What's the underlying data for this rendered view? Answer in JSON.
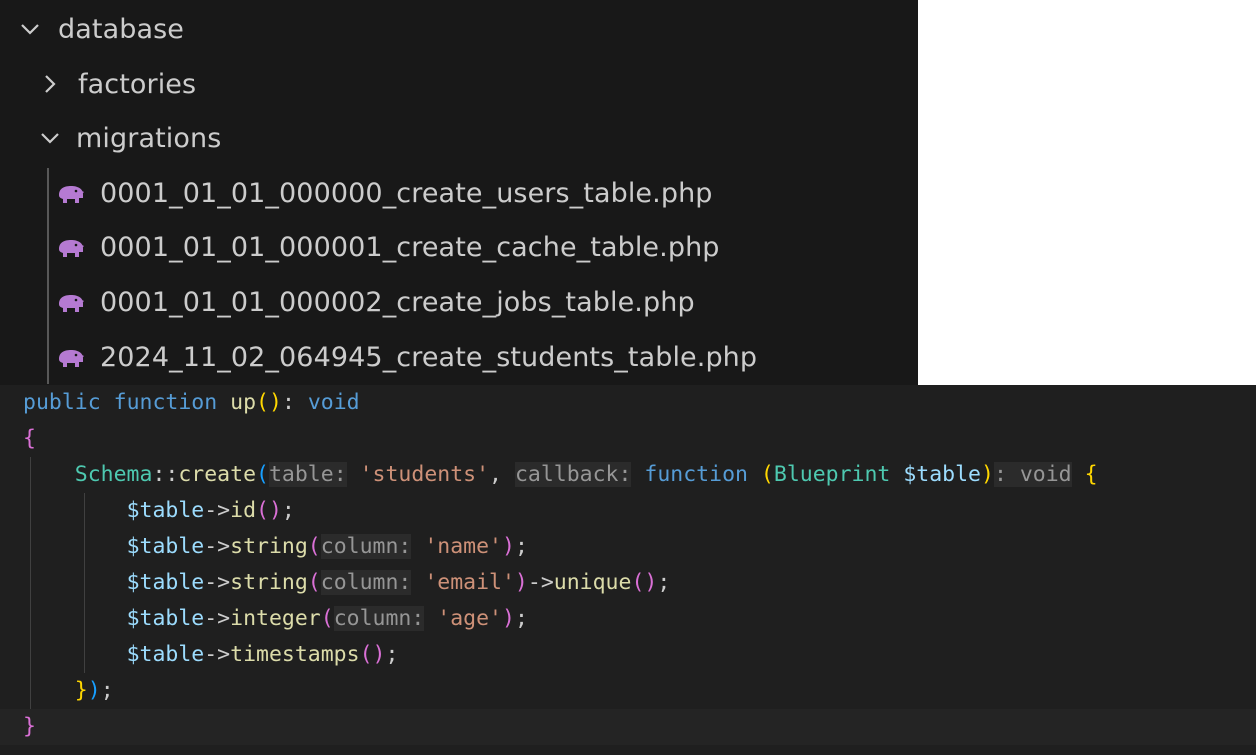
{
  "explorer": {
    "folders": {
      "database": "database",
      "factories": "factories",
      "migrations": "migrations"
    },
    "files": [
      "0001_01_01_000000_create_users_table.php",
      "0001_01_01_000001_create_cache_table.php",
      "0001_01_01_000002_create_jobs_table.php",
      "2024_11_02_064945_create_students_table.php"
    ],
    "file_icon": "php-elephant-icon",
    "colors": {
      "background": "#181818",
      "text": "#cccccc",
      "php_icon": "#b57ad2"
    }
  },
  "editor": {
    "colors": {
      "background": "#1f1f1f",
      "keyword": "#569cd6",
      "function": "#dcdcaa",
      "class": "#4ec9b0",
      "variable": "#9cdcfe",
      "string": "#ce9178",
      "inlay_hint": "#969696"
    },
    "lines": {
      "l0": {
        "kw_public": "public",
        "kw_function": "function",
        "name": "up",
        "paren_open": "(",
        "paren_close": ")",
        "colon": ":",
        "ret": "void"
      },
      "l1": {
        "brace": "{"
      },
      "l2": {
        "class": "Schema",
        "op": "::",
        "method": "create",
        "paren_open": "(",
        "hint_table": "table:",
        "arg_table": "'students'",
        "comma1": ",",
        "hint_callback": "callback:",
        "kw_function": "function",
        "paren_open2": "(",
        "type": "Blueprint",
        "param": "$table",
        "paren_close2": ")",
        "ret_hint": ": void",
        "brace_open": "{"
      },
      "l3": {
        "var": "$table",
        "arrow": "->",
        "method": "id",
        "parens": "()",
        "semi": ";"
      },
      "l4": {
        "var": "$table",
        "arrow": "->",
        "method": "string",
        "paren_open": "(",
        "hint": "column:",
        "arg": "'name'",
        "paren_close": ")",
        "semi": ";"
      },
      "l5": {
        "var": "$table",
        "arrow": "->",
        "method": "string",
        "paren_open": "(",
        "hint": "column:",
        "arg": "'email'",
        "paren_close": ")",
        "arrow2": "->",
        "method2": "unique",
        "parens2": "()",
        "semi": ";"
      },
      "l6": {
        "var": "$table",
        "arrow": "->",
        "method": "integer",
        "paren_open": "(",
        "hint": "column:",
        "arg": "'age'",
        "paren_close": ")",
        "semi": ";"
      },
      "l7": {
        "var": "$table",
        "arrow": "->",
        "method": "timestamps",
        "parens": "()",
        "semi": ";"
      },
      "l8": {
        "brace_close": "}",
        "paren_close": ")",
        "semi": ";"
      },
      "l9": {
        "brace": "}"
      }
    }
  }
}
